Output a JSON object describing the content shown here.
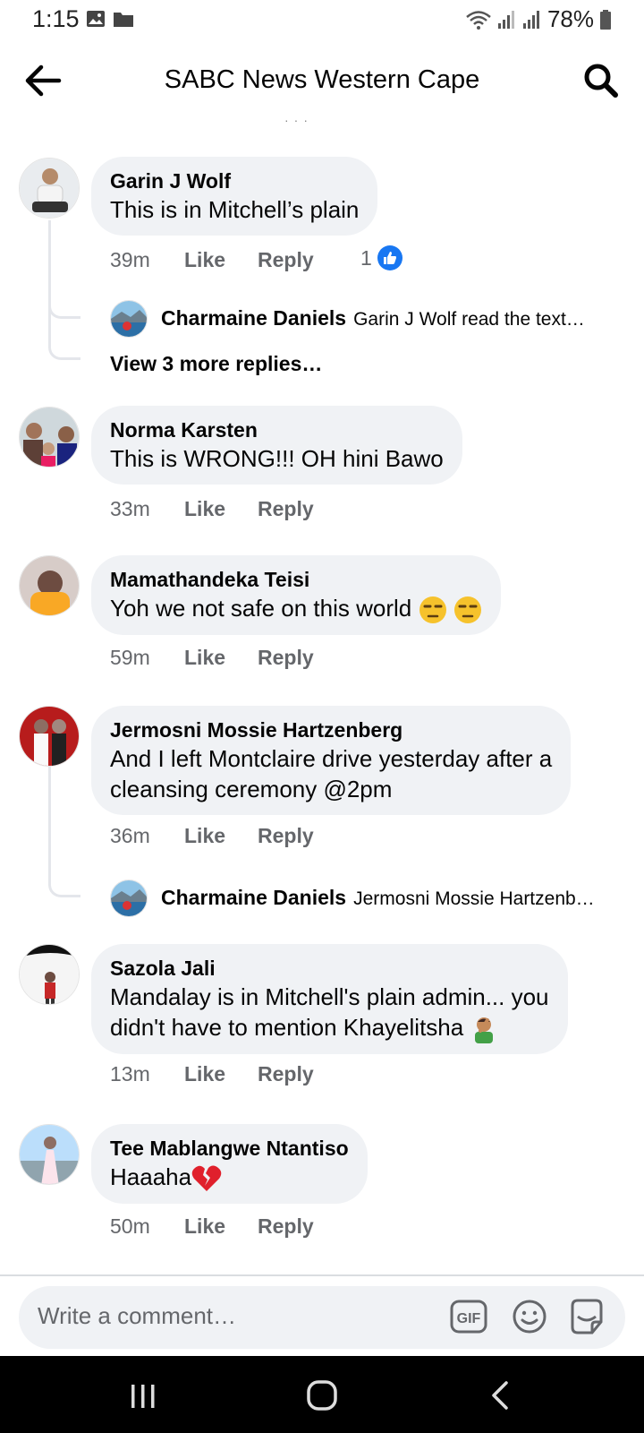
{
  "status_bar": {
    "time": "1:15",
    "battery": "78%"
  },
  "header": {
    "title": "SABC News Western Cape"
  },
  "comments": [
    {
      "name": "Garin J Wolf",
      "text": "This is in Mitchell’s plain",
      "time": "39m",
      "like": "Like",
      "reply": "Reply",
      "reactions": "1",
      "reply_preview": {
        "name": "Charmaine Daniels",
        "text": "Garin J Wolf read the   text…"
      },
      "view_more": "View 3 more replies…"
    },
    {
      "name": "Norma Karsten",
      "text": "This is WRONG!!! OH hini Bawo",
      "time": "33m",
      "like": "Like",
      "reply": "Reply"
    },
    {
      "name": "Mamathandeka Teisi",
      "text": "Yoh we not safe on this world",
      "time": "59m",
      "like": "Like",
      "reply": "Reply"
    },
    {
      "name": "Jermosni Mossie Hartzenberg",
      "text_line1": "And I left Montclaire drive yesterday after a",
      "text_line2": "cleansing ceremony @2pm",
      "time": "36m",
      "like": "Like",
      "reply": "Reply",
      "reply_preview": {
        "name": "Charmaine Daniels",
        "text": "Jermosni Mossie Hartzenb…"
      }
    },
    {
      "name": "Sazola Jali",
      "text_line1": "Mandalay is in Mitchell's plain admin... you",
      "text_line2": "didn't have to mention Khayelitsha",
      "time": "13m",
      "like": "Like",
      "reply": "Reply"
    },
    {
      "name": "Tee Mablangwe Ntantiso",
      "text": "Haaaha",
      "time": "50m",
      "like": "Like",
      "reply": "Reply"
    }
  ],
  "composer": {
    "placeholder": "Write a comment…",
    "gif_label": "GIF"
  },
  "colors": {
    "accent": "#1877f2",
    "bubble": "#f0f2f5",
    "secondary_text": "#65676b"
  },
  "icons": [
    "back-arrow-icon",
    "search-icon",
    "like-reaction-icon",
    "gif-icon",
    "emoji-icon",
    "sticker-icon",
    "recents-icon",
    "home-icon",
    "back-nav-icon"
  ]
}
